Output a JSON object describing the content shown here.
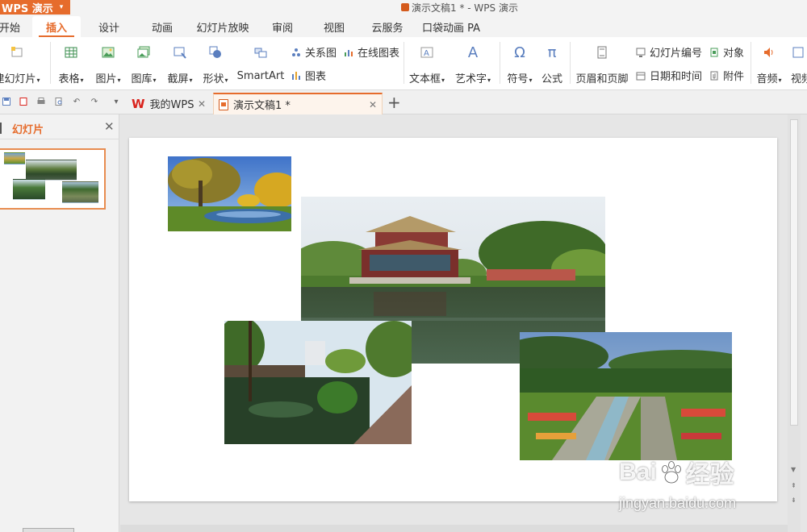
{
  "titlebar": {
    "app_name": "WPS 演示",
    "caret": "▾",
    "window_title": "演示文稿1 * - WPS 演示"
  },
  "ribbon_tabs": [
    {
      "label": "开始"
    },
    {
      "label": "插入",
      "active": true
    },
    {
      "label": "设计"
    },
    {
      "label": "动画"
    },
    {
      "label": "幻灯片放映"
    },
    {
      "label": "审阅"
    },
    {
      "label": "视图"
    },
    {
      "label": "云服务"
    },
    {
      "label": "口袋动画 PA"
    }
  ],
  "ribbon": {
    "new_slide": "建幻灯片",
    "table": "表格",
    "picture": "图片",
    "gallery": "图库",
    "screenshot": "截屏",
    "shape": "形状",
    "smartart": "SmartArt",
    "relation_chart": "关系图",
    "online_chart": "在线图表",
    "chart": "图表",
    "textbox": "文本框",
    "wordart": "艺术字",
    "symbol": "符号",
    "formula": "公式",
    "header_footer": "页眉和页脚",
    "slide_number": "幻灯片编号",
    "object": "对象",
    "datetime": "日期和时间",
    "attachment": "附件",
    "audio": "音频",
    "video": "视频"
  },
  "doc_tabs": [
    {
      "label": "我的WPS"
    },
    {
      "label": "演示文稿1 *",
      "active": true
    }
  ],
  "slide_panel": {
    "title": "幻灯片"
  },
  "icons": {
    "close": "✕",
    "add_tab": "+",
    "omega": "Ω",
    "pi": "π",
    "text_a": "A"
  },
  "watermark": {
    "brand_left": "Bai",
    "brand_right": "经验",
    "url": "jingyan.baidu.com"
  },
  "colors": {
    "accent": "#e66c2c",
    "wps_red": "#d9231d"
  }
}
